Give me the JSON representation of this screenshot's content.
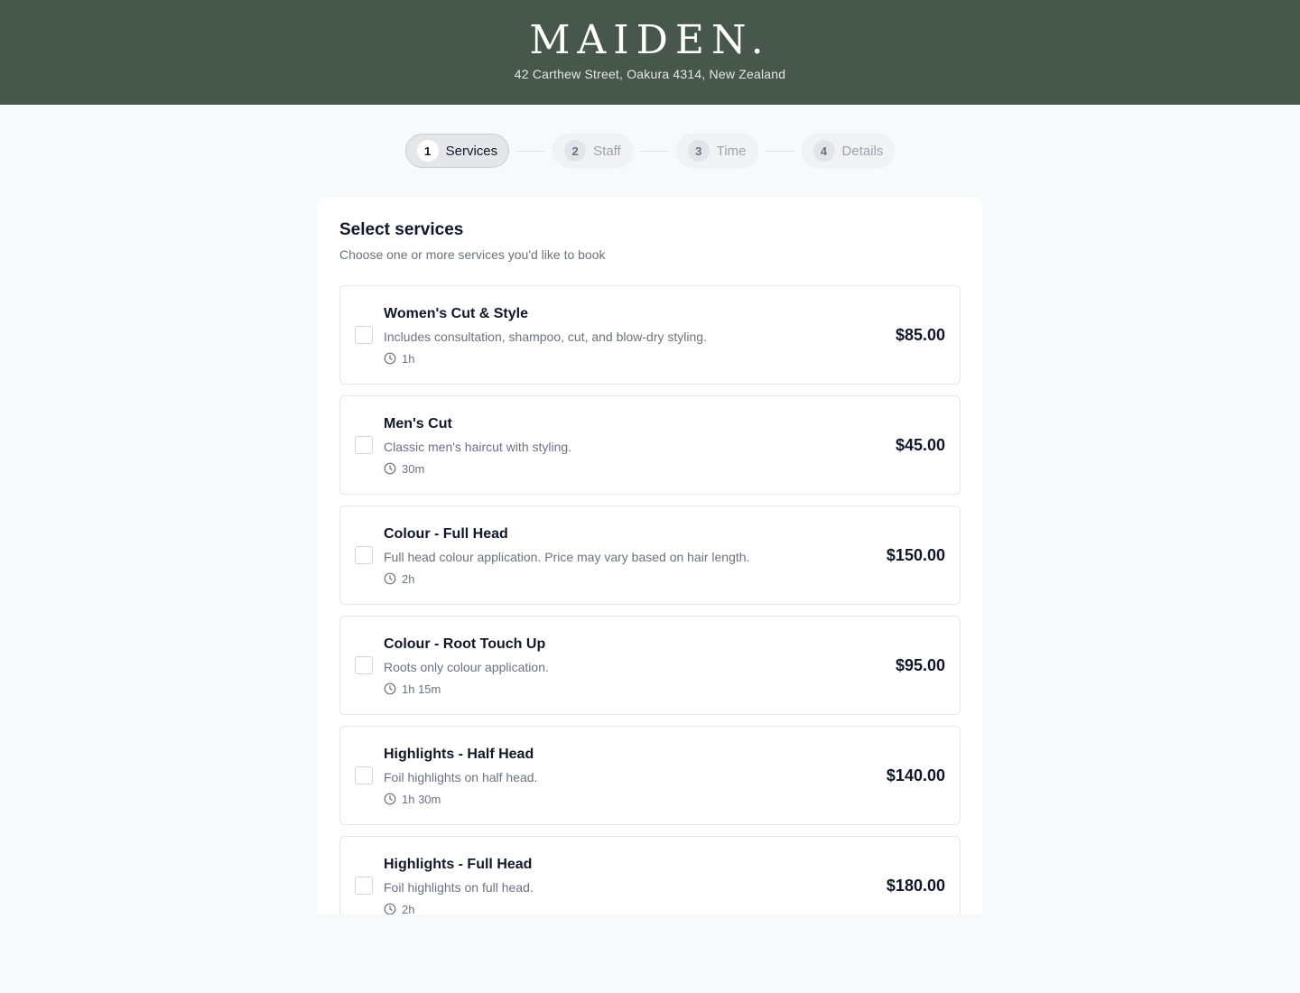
{
  "header": {
    "logo": "MAIDEN.",
    "address": "42 Carthew Street, Oakura 4314, New Zealand"
  },
  "steps": [
    {
      "num": "1",
      "label": "Services",
      "active": true
    },
    {
      "num": "2",
      "label": "Staff",
      "active": false
    },
    {
      "num": "3",
      "label": "Time",
      "active": false
    },
    {
      "num": "4",
      "label": "Details",
      "active": false
    }
  ],
  "card": {
    "title": "Select services",
    "subtitle": "Choose one or more services you'd like to book"
  },
  "services": [
    {
      "name": "Women's Cut & Style",
      "description": "Includes consultation, shampoo, cut, and blow-dry styling.",
      "duration": "1h",
      "price": "$85.00"
    },
    {
      "name": "Men's Cut",
      "description": "Classic men's haircut with styling.",
      "duration": "30m",
      "price": "$45.00"
    },
    {
      "name": "Colour - Full Head",
      "description": "Full head colour application. Price may vary based on hair length.",
      "duration": "2h",
      "price": "$150.00"
    },
    {
      "name": "Colour - Root Touch Up",
      "description": "Roots only colour application.",
      "duration": "1h 15m",
      "price": "$95.00"
    },
    {
      "name": "Highlights - Half Head",
      "description": "Foil highlights on half head.",
      "duration": "1h 30m",
      "price": "$140.00"
    },
    {
      "name": "Highlights - Full Head",
      "description": "Foil highlights on full head.",
      "duration": "2h",
      "price": "$180.00"
    }
  ],
  "colors": {
    "header_bg": "#47574c",
    "page_bg": "#f8f9fb"
  },
  "icons": {
    "duration": "clock-icon"
  }
}
